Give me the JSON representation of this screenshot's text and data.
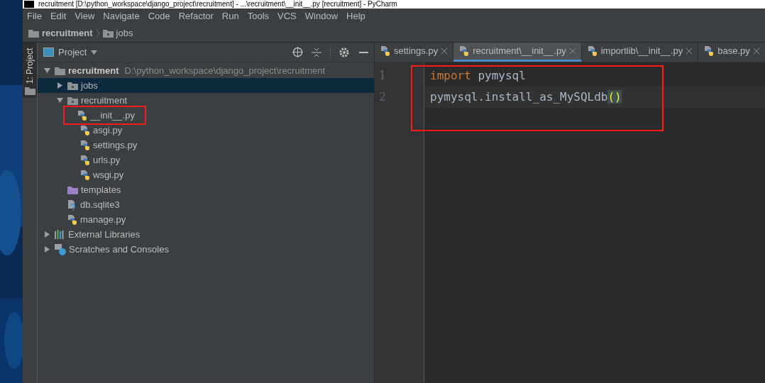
{
  "window": {
    "title": "recruitment [D:\\python_workspace\\django_project\\recruitment] - ...\\recruitment\\__init__.py [recruitment] - PyCharm"
  },
  "menu": [
    "File",
    "Edit",
    "View",
    "Navigate",
    "Code",
    "Refactor",
    "Run",
    "Tools",
    "VCS",
    "Window",
    "Help"
  ],
  "breadcrumb": [
    {
      "label": "recruitment",
      "kind": "folder"
    },
    {
      "label": "jobs",
      "kind": "package"
    }
  ],
  "tool_stripe": {
    "label": "1: Project"
  },
  "project_panel": {
    "title": "Project",
    "tree": [
      {
        "label": "recruitment",
        "path": "D:\\python_workspace\\django_project\\recruitment",
        "kind": "folder",
        "expanded": true,
        "selected": false,
        "boxed": false,
        "children": [
          {
            "label": "jobs",
            "kind": "package",
            "expanded": false,
            "selected": true,
            "boxed": false
          },
          {
            "label": "recruitment",
            "kind": "package",
            "expanded": true,
            "selected": false,
            "boxed": false,
            "children": [
              {
                "label": "__init__.py",
                "kind": "python",
                "selected": false,
                "boxed": true
              },
              {
                "label": "asgi.py",
                "kind": "python",
                "selected": false,
                "boxed": false
              },
              {
                "label": "settings.py",
                "kind": "python",
                "selected": false,
                "boxed": false
              },
              {
                "label": "urls.py",
                "kind": "python",
                "selected": false,
                "boxed": false
              },
              {
                "label": "wsgi.py",
                "kind": "python",
                "selected": false,
                "boxed": false
              }
            ]
          },
          {
            "label": "templates",
            "kind": "templates",
            "selected": false,
            "boxed": false
          },
          {
            "label": "db.sqlite3",
            "kind": "unknown",
            "selected": false,
            "boxed": false
          },
          {
            "label": "manage.py",
            "kind": "python",
            "selected": false,
            "boxed": false
          }
        ]
      },
      {
        "label": "External Libraries",
        "kind": "libraries",
        "expanded": false,
        "selected": false,
        "boxed": false
      },
      {
        "label": "Scratches and Consoles",
        "kind": "scratches",
        "expanded": false,
        "selected": false,
        "boxed": false
      }
    ]
  },
  "editor": {
    "tabs": [
      {
        "label": "settings.py",
        "selected": false
      },
      {
        "label": "recruitment\\__init__.py",
        "selected": true
      },
      {
        "label": "importlib\\__init__.py",
        "selected": false
      },
      {
        "label": "base.py",
        "selected": false
      }
    ],
    "boxed": true,
    "lines": [
      {
        "number": "1",
        "tokens": [
          {
            "text": "import",
            "kind": "keyword"
          },
          {
            "text": " pymysql",
            "kind": "plain"
          }
        ]
      },
      {
        "number": "2",
        "tokens": [
          {
            "text": "pymysql.install_as_MySQLdb",
            "kind": "plain"
          },
          {
            "text": "()",
            "kind": "brace"
          }
        ]
      }
    ]
  }
}
